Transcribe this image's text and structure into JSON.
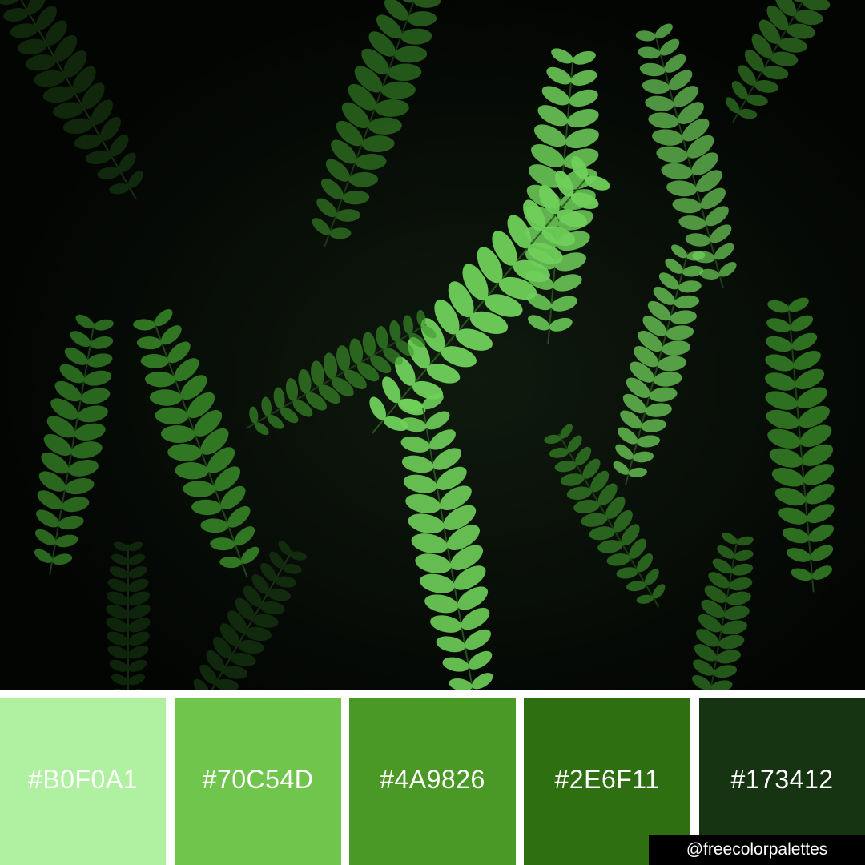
{
  "swatches": [
    {
      "hex": "#B0F0A1",
      "label": "#B0F0A1"
    },
    {
      "hex": "#70C54D",
      "label": "#70C54D"
    },
    {
      "hex": "#4A9826",
      "label": "#4A9826"
    },
    {
      "hex": "#2E6F11",
      "label": "#2E6F11"
    },
    {
      "hex": "#173412",
      "label": "#173412"
    }
  ],
  "handle": "@freecolorpalettes",
  "colors": {
    "leaf_light": "#6fd05a",
    "leaf_mid": "#3f9a2c",
    "leaf_dark": "#1d4a16",
    "background": "#050805"
  }
}
